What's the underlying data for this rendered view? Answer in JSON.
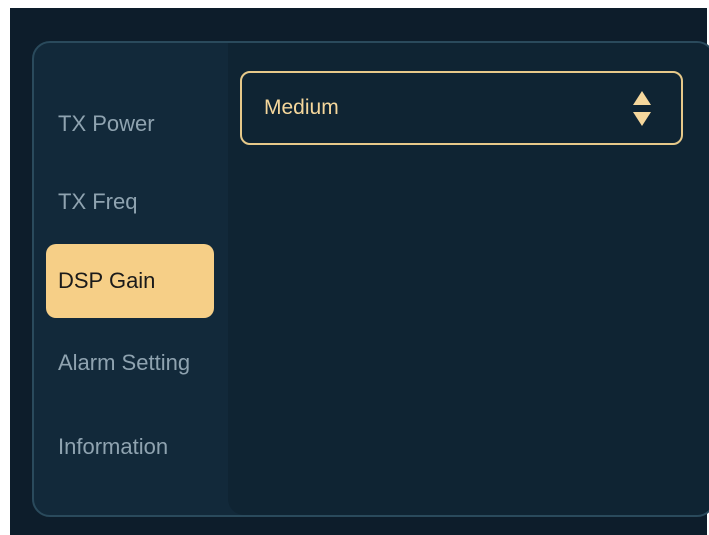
{
  "menu": {
    "items": [
      {
        "label": "TX Power"
      },
      {
        "label": "TX Freq"
      },
      {
        "label": "DSP Gain"
      },
      {
        "label": "Alarm Setting"
      },
      {
        "label": "Information"
      }
    ],
    "active_index": 2
  },
  "dsp_gain": {
    "selected_value": "Medium"
  },
  "colors": {
    "accent": "#f6cf87",
    "select_border": "#e6c98a",
    "select_text": "#f5d79c",
    "menu_text": "#8fa3b0",
    "background": "#0d1d2b"
  },
  "icons": {
    "select_arrows": "up-down-arrows-icon"
  }
}
